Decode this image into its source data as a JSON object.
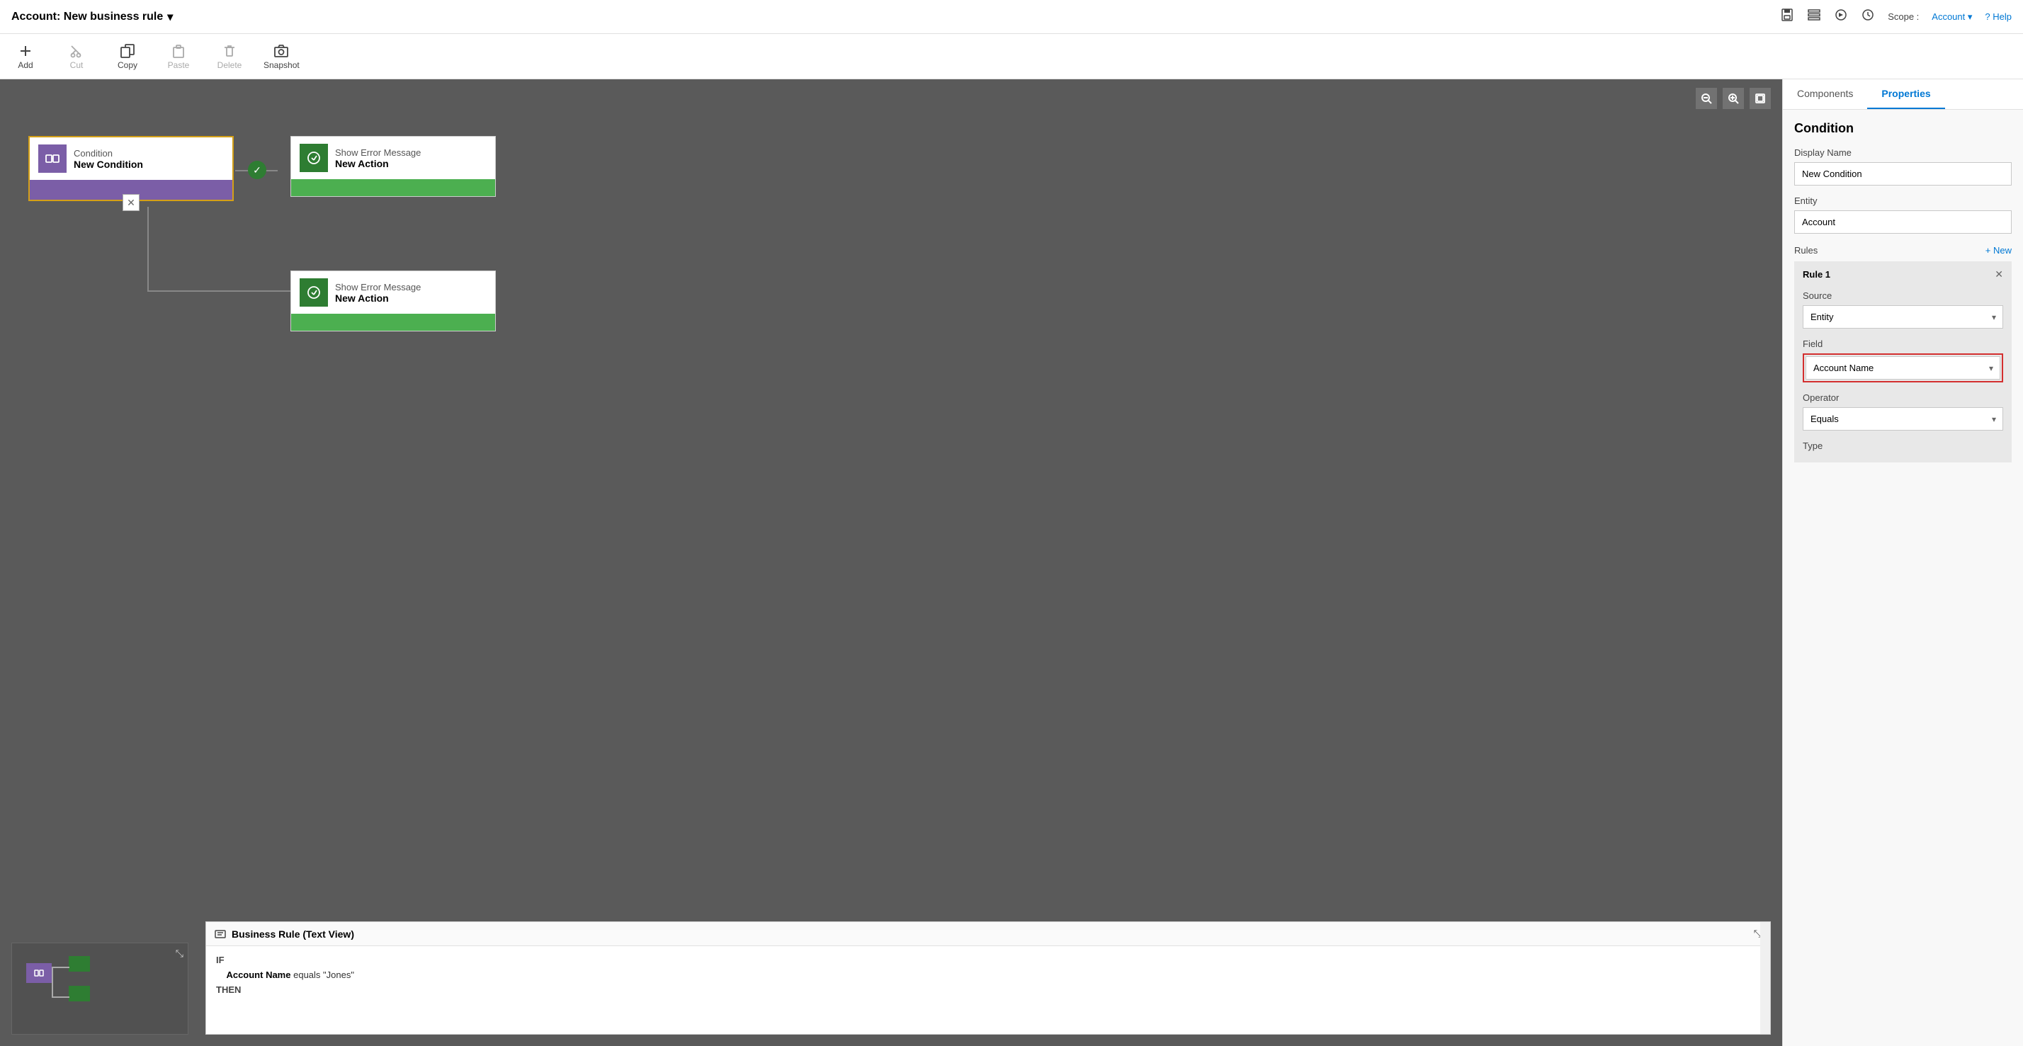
{
  "titleBar": {
    "title": "Account: New business rule",
    "dropdownIcon": "▾",
    "toolbar_icons": [
      "save",
      "properties",
      "activate",
      "history"
    ],
    "scope_label": "Scope :",
    "scope_value": "Account",
    "help_label": "? Help"
  },
  "toolbar": {
    "items": [
      {
        "id": "add",
        "label": "Add",
        "icon": "+"
      },
      {
        "id": "cut",
        "label": "Cut",
        "icon": "✂"
      },
      {
        "id": "copy",
        "label": "Copy",
        "icon": "📋"
      },
      {
        "id": "paste",
        "label": "Paste",
        "icon": "📄"
      },
      {
        "id": "delete",
        "label": "Delete",
        "icon": "🗑"
      },
      {
        "id": "snapshot",
        "label": "Snapshot",
        "icon": "📷"
      }
    ]
  },
  "canvas": {
    "nodes": {
      "condition": {
        "type_label": "Condition",
        "name": "New Condition"
      },
      "action_true": {
        "type_label": "Show Error Message",
        "name": "New Action"
      },
      "action_false": {
        "type_label": "Show Error Message",
        "name": "New Action"
      }
    }
  },
  "textView": {
    "title": "Business Rule (Text View)",
    "if_label": "IF",
    "condition_text": "Account Name equals \"Jones\"",
    "then_label": "THEN"
  },
  "rightPanel": {
    "tabs": [
      {
        "id": "components",
        "label": "Components"
      },
      {
        "id": "properties",
        "label": "Properties"
      }
    ],
    "activeTab": "properties",
    "section_title": "Condition",
    "display_name_label": "Display Name",
    "display_name_value": "New Condition",
    "entity_label": "Entity",
    "entity_value": "Account",
    "rules_label": "Rules",
    "new_link": "+ New",
    "rule": {
      "title": "Rule 1",
      "source_label": "Source",
      "source_value": "Entity",
      "field_label": "Field",
      "field_value": "Account Name",
      "operator_label": "Operator",
      "operator_value": "Equals",
      "type_label": "Type"
    }
  }
}
